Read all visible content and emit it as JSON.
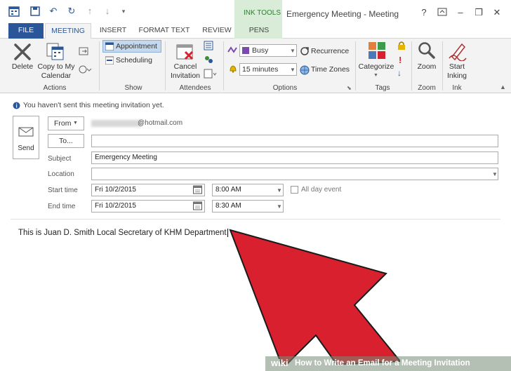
{
  "window": {
    "ink_tools_label": "INK TOOLS",
    "title": "Emergency Meeting - Meeting",
    "help": "?",
    "minimize": "–",
    "restore": "❐",
    "close": "✕"
  },
  "tabs": [
    "FILE",
    "MEETING",
    "INSERT",
    "FORMAT TEXT",
    "REVIEW",
    "PENS"
  ],
  "ribbon": {
    "actions": {
      "delete": "Delete",
      "copy_line1": "Copy to My",
      "copy_line2": "Calendar",
      "group": "Actions"
    },
    "show": {
      "appointment": "Appointment",
      "scheduling": "Scheduling",
      "group": "Show"
    },
    "attendees": {
      "cancel_line1": "Cancel",
      "cancel_line2": "Invitation",
      "group": "Attendees"
    },
    "options": {
      "busy": "Busy",
      "reminder": "15 minutes",
      "recurrence": "Recurrence",
      "time_zones": "Time Zones",
      "group": "Options"
    },
    "tags": {
      "categorize": "Categorize",
      "group": "Tags"
    },
    "zoom": {
      "zoom": "Zoom",
      "group": "Zoom"
    },
    "ink": {
      "start_line1": "Start",
      "start_line2": "Inking",
      "group": "Ink"
    }
  },
  "info_message": "You haven't sent this meeting invitation yet.",
  "form": {
    "send": "Send",
    "from_label": "From",
    "from_value": "@hotmail.com",
    "to_label": "To...",
    "to_value": "",
    "subject_label": "Subject",
    "subject_value": "Emergency Meeting",
    "location_label": "Location",
    "location_value": "",
    "start_label": "Start time",
    "start_date": "Fri 10/2/2015",
    "start_time": "8:00 AM",
    "end_label": "End time",
    "end_date": "Fri 10/2/2015",
    "end_time": "8:30 AM",
    "all_day_label": "All day event"
  },
  "body_text": "This is Juan D. Smith Local Secretary of KHM Department",
  "watermark": {
    "wiki": "wiki",
    "how": "How to Write an Email for a Meeting Invitation"
  },
  "colors": {
    "accent": "#2b579a",
    "ink_tools": "#d9ecd8",
    "arrow": "#d9202e"
  }
}
